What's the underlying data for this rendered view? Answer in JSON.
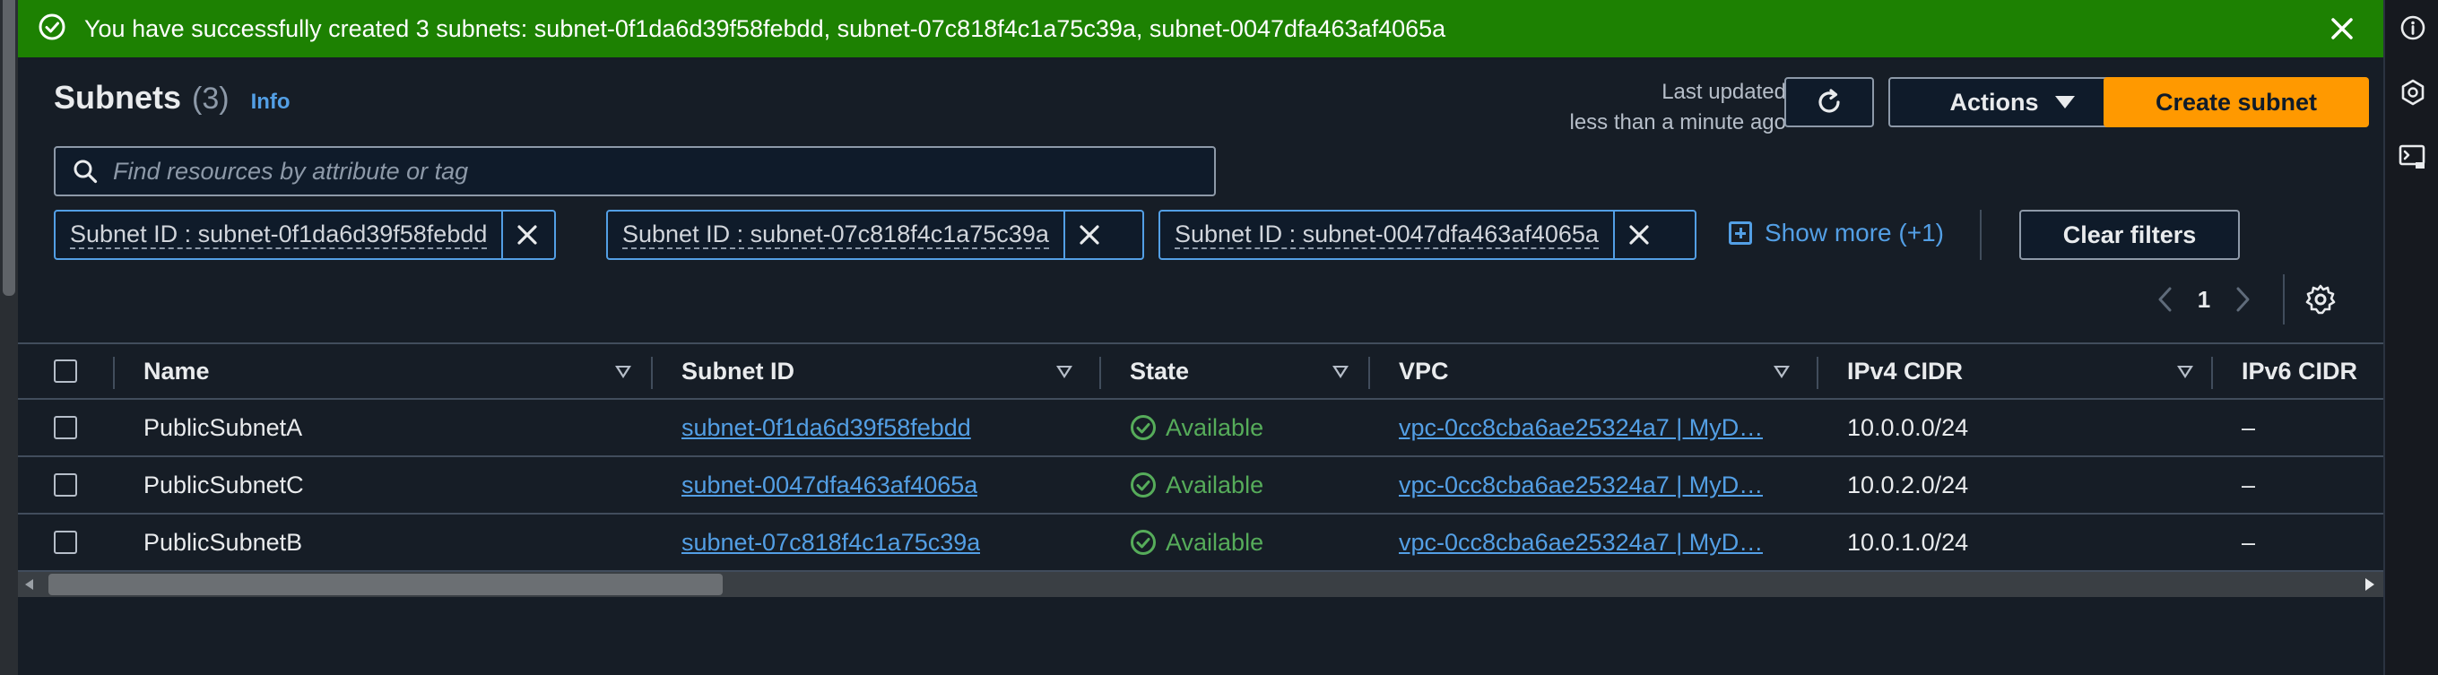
{
  "flash": {
    "message": "You have successfully created 3 subnets: subnet-0f1da6d39f58febdd, subnet-07c818f4c1a75c39a, subnet-0047dfa463af4065a",
    "color": "#1d8102"
  },
  "header": {
    "title": "Subnets",
    "count": "(3)",
    "info": "Info",
    "last_updated_line1": "Last updated",
    "last_updated_line2": "less than a minute ago",
    "actions_label": "Actions",
    "create_label": "Create subnet",
    "accent": "#ff9900"
  },
  "search": {
    "placeholder": "Find resources by attribute or tag"
  },
  "filters": {
    "tokens": [
      "Subnet ID : subnet-0f1da6d39f58febdd",
      "Subnet ID : subnet-07c818f4c1a75c39a",
      "Subnet ID : subnet-0047dfa463af4065a"
    ],
    "show_more": "Show more (+1)",
    "clear_label": "Clear filters"
  },
  "pagination": {
    "current_page": "1"
  },
  "table": {
    "columns": [
      "Name",
      "Subnet ID",
      "State",
      "VPC",
      "IPv4 CIDR",
      "IPv6 CIDR"
    ],
    "rows": [
      {
        "name": "PublicSubnetA",
        "subnet_id": "subnet-0f1da6d39f58febdd",
        "state": "Available",
        "vpc": "vpc-0cc8cba6ae25324a7 | MyD…",
        "ipv4": "10.0.0.0/24",
        "ipv6": "–"
      },
      {
        "name": "PublicSubnetC",
        "subnet_id": "subnet-0047dfa463af4065a",
        "state": "Available",
        "vpc": "vpc-0cc8cba6ae25324a7 | MyD…",
        "ipv4": "10.0.2.0/24",
        "ipv6": "–"
      },
      {
        "name": "PublicSubnetB",
        "subnet_id": "subnet-07c818f4c1a75c39a",
        "state": "Available",
        "vpc": "vpc-0cc8cba6ae25324a7 | MyD…",
        "ipv4": "10.0.1.0/24",
        "ipv6": "–"
      }
    ]
  },
  "icons": {
    "flash": "check-circle-icon",
    "close": "close-icon",
    "refresh": "refresh-icon",
    "search": "search-icon",
    "settings": "gear-icon",
    "rail": [
      "info-icon",
      "hexagon-icon",
      "cloudshell-icon"
    ]
  }
}
